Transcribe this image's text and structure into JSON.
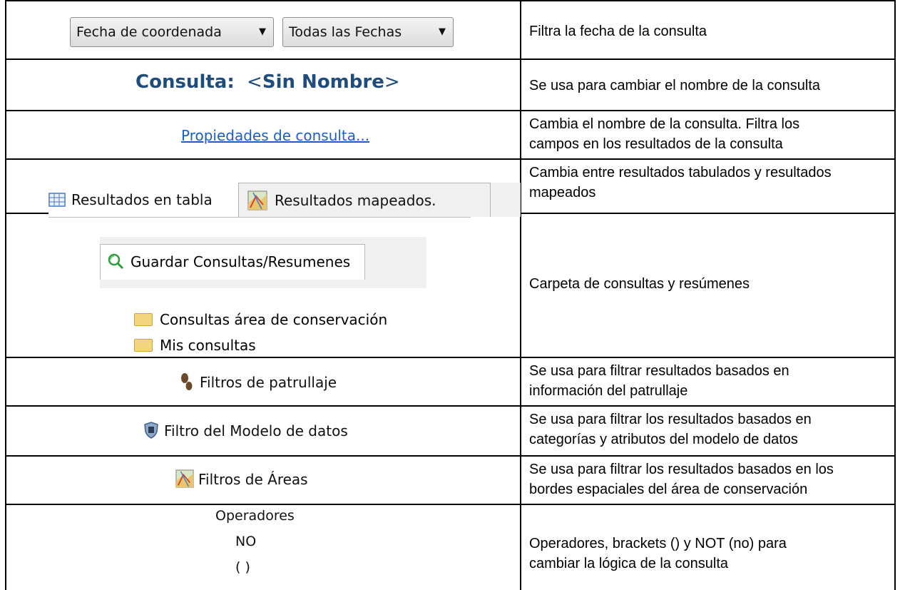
{
  "rows": [
    {
      "dropdowns": [
        {
          "label": "Fecha de coordenada",
          "arrow": "▼"
        },
        {
          "label": "Todas las Fechas",
          "arrow": "▼"
        }
      ],
      "description": "Filtra la fecha de la consulta"
    },
    {
      "label_prefix": "Consulta:",
      "label_name": "Sin Nombre",
      "description": "Se usa para cambiar el nombre de la consulta"
    },
    {
      "link_text": "Propiedades de consulta...",
      "description_lines": [
        "Cambia el nombre de la consulta. Filtra los",
        "campos en los resultados de la consulta"
      ]
    },
    {
      "tabs": [
        {
          "label": "Resultados en tabla",
          "icon": "table-icon"
        },
        {
          "label": "Resultados mapeados.",
          "icon": "map-icon"
        }
      ],
      "description_lines": [
        "Cambia entre resultados tabulados y resultados",
        "mapeados"
      ]
    },
    {
      "panel_tab_label": "Guardar Consultas/Resumenes",
      "panel_tab_icon": "saved-queries-icon",
      "folders": [
        "Consultas área de conservación",
        "Mis consultas"
      ],
      "description": "Carpeta de consultas y resúmenes"
    },
    {
      "label": "Filtros de patrullaje",
      "icon": "footprints-icon",
      "description_lines": [
        "Se usa para filtrar resultados basados en",
        "información del patrullaje"
      ]
    },
    {
      "label": "Filtro del Modelo de datos",
      "icon": "shield-icon",
      "description_lines": [
        "Se usa para filtrar los resultados basados en",
        "categorías y atributos del modelo de datos"
      ]
    },
    {
      "label": "Filtros de Áreas",
      "icon": "map-icon",
      "description_lines": [
        "Se usa para filtrar los resultados basados en los",
        "bordes espaciales del área de conservación"
      ]
    },
    {
      "header": "Operadores",
      "items": [
        "NO",
        "( )"
      ],
      "description_lines": [
        "Operadores, brackets () y NOT (no) para",
        "cambiar la lógica de la consulta"
      ]
    }
  ],
  "colors": {
    "consulta_title": "#1e4d7b",
    "link": "#1a5fc9",
    "grid": "#000000"
  }
}
